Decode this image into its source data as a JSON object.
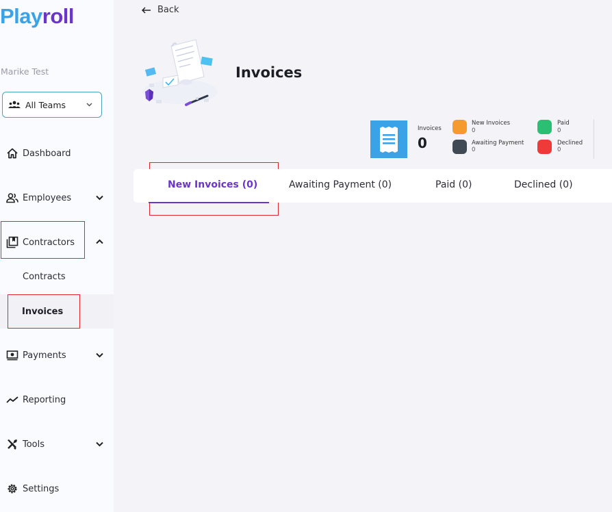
{
  "brand": {
    "part1": "Play",
    "part2": "roll"
  },
  "user": {
    "name": "Marike Test"
  },
  "team_select": {
    "value": "All Teams"
  },
  "nav": {
    "dashboard": "Dashboard",
    "employees": "Employees",
    "contractors": "Contractors",
    "contracts": "Contracts",
    "invoices": "Invoices",
    "payments": "Payments",
    "reporting": "Reporting",
    "tools": "Tools",
    "settings": "Settings"
  },
  "header": {
    "back_label": "Back",
    "title": "Invoices"
  },
  "stats": {
    "main_label": "Invoices",
    "main_value": "0",
    "legend": [
      {
        "label": "New Invoices",
        "value": "0",
        "color": "#f59a2f"
      },
      {
        "label": "Paid",
        "value": "0",
        "color": "#2bbf73"
      },
      {
        "label": "Awaiting Payment",
        "value": "0",
        "color": "#3f4a55"
      },
      {
        "label": "Declined",
        "value": "0",
        "color": "#ef3a3a"
      }
    ]
  },
  "tabs": [
    {
      "label": "New Invoices (0)",
      "active": true
    },
    {
      "label": "Awaiting Payment (0)",
      "active": false
    },
    {
      "label": "Paid (0)",
      "active": false
    },
    {
      "label": "Declined (0)",
      "active": false
    }
  ],
  "colors": {
    "accent": "#6a35c8",
    "brand_blue": "#3aa3e8",
    "highlight_box": "#e0262b"
  }
}
